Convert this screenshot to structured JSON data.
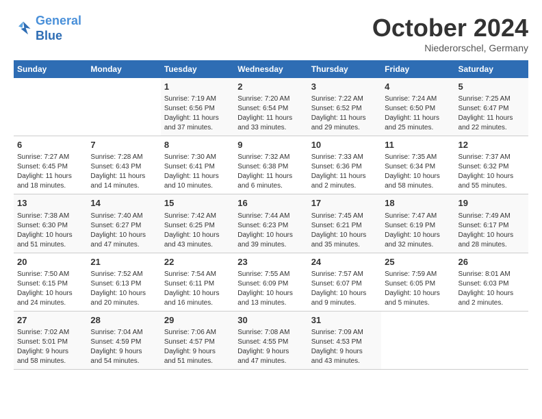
{
  "logo": {
    "line1": "General",
    "line2": "Blue"
  },
  "title": "October 2024",
  "location": "Niederorschel, Germany",
  "weekdays": [
    "Sunday",
    "Monday",
    "Tuesday",
    "Wednesday",
    "Thursday",
    "Friday",
    "Saturday"
  ],
  "weeks": [
    [
      {
        "day": "",
        "info": ""
      },
      {
        "day": "",
        "info": ""
      },
      {
        "day": "1",
        "info": "Sunrise: 7:19 AM\nSunset: 6:56 PM\nDaylight: 11 hours\nand 37 minutes."
      },
      {
        "day": "2",
        "info": "Sunrise: 7:20 AM\nSunset: 6:54 PM\nDaylight: 11 hours\nand 33 minutes."
      },
      {
        "day": "3",
        "info": "Sunrise: 7:22 AM\nSunset: 6:52 PM\nDaylight: 11 hours\nand 29 minutes."
      },
      {
        "day": "4",
        "info": "Sunrise: 7:24 AM\nSunset: 6:50 PM\nDaylight: 11 hours\nand 25 minutes."
      },
      {
        "day": "5",
        "info": "Sunrise: 7:25 AM\nSunset: 6:47 PM\nDaylight: 11 hours\nand 22 minutes."
      }
    ],
    [
      {
        "day": "6",
        "info": "Sunrise: 7:27 AM\nSunset: 6:45 PM\nDaylight: 11 hours\nand 18 minutes."
      },
      {
        "day": "7",
        "info": "Sunrise: 7:28 AM\nSunset: 6:43 PM\nDaylight: 11 hours\nand 14 minutes."
      },
      {
        "day": "8",
        "info": "Sunrise: 7:30 AM\nSunset: 6:41 PM\nDaylight: 11 hours\nand 10 minutes."
      },
      {
        "day": "9",
        "info": "Sunrise: 7:32 AM\nSunset: 6:38 PM\nDaylight: 11 hours\nand 6 minutes."
      },
      {
        "day": "10",
        "info": "Sunrise: 7:33 AM\nSunset: 6:36 PM\nDaylight: 11 hours\nand 2 minutes."
      },
      {
        "day": "11",
        "info": "Sunrise: 7:35 AM\nSunset: 6:34 PM\nDaylight: 10 hours\nand 58 minutes."
      },
      {
        "day": "12",
        "info": "Sunrise: 7:37 AM\nSunset: 6:32 PM\nDaylight: 10 hours\nand 55 minutes."
      }
    ],
    [
      {
        "day": "13",
        "info": "Sunrise: 7:38 AM\nSunset: 6:30 PM\nDaylight: 10 hours\nand 51 minutes."
      },
      {
        "day": "14",
        "info": "Sunrise: 7:40 AM\nSunset: 6:27 PM\nDaylight: 10 hours\nand 47 minutes."
      },
      {
        "day": "15",
        "info": "Sunrise: 7:42 AM\nSunset: 6:25 PM\nDaylight: 10 hours\nand 43 minutes."
      },
      {
        "day": "16",
        "info": "Sunrise: 7:44 AM\nSunset: 6:23 PM\nDaylight: 10 hours\nand 39 minutes."
      },
      {
        "day": "17",
        "info": "Sunrise: 7:45 AM\nSunset: 6:21 PM\nDaylight: 10 hours\nand 35 minutes."
      },
      {
        "day": "18",
        "info": "Sunrise: 7:47 AM\nSunset: 6:19 PM\nDaylight: 10 hours\nand 32 minutes."
      },
      {
        "day": "19",
        "info": "Sunrise: 7:49 AM\nSunset: 6:17 PM\nDaylight: 10 hours\nand 28 minutes."
      }
    ],
    [
      {
        "day": "20",
        "info": "Sunrise: 7:50 AM\nSunset: 6:15 PM\nDaylight: 10 hours\nand 24 minutes."
      },
      {
        "day": "21",
        "info": "Sunrise: 7:52 AM\nSunset: 6:13 PM\nDaylight: 10 hours\nand 20 minutes."
      },
      {
        "day": "22",
        "info": "Sunrise: 7:54 AM\nSunset: 6:11 PM\nDaylight: 10 hours\nand 16 minutes."
      },
      {
        "day": "23",
        "info": "Sunrise: 7:55 AM\nSunset: 6:09 PM\nDaylight: 10 hours\nand 13 minutes."
      },
      {
        "day": "24",
        "info": "Sunrise: 7:57 AM\nSunset: 6:07 PM\nDaylight: 10 hours\nand 9 minutes."
      },
      {
        "day": "25",
        "info": "Sunrise: 7:59 AM\nSunset: 6:05 PM\nDaylight: 10 hours\nand 5 minutes."
      },
      {
        "day": "26",
        "info": "Sunrise: 8:01 AM\nSunset: 6:03 PM\nDaylight: 10 hours\nand 2 minutes."
      }
    ],
    [
      {
        "day": "27",
        "info": "Sunrise: 7:02 AM\nSunset: 5:01 PM\nDaylight: 9 hours\nand 58 minutes."
      },
      {
        "day": "28",
        "info": "Sunrise: 7:04 AM\nSunset: 4:59 PM\nDaylight: 9 hours\nand 54 minutes."
      },
      {
        "day": "29",
        "info": "Sunrise: 7:06 AM\nSunset: 4:57 PM\nDaylight: 9 hours\nand 51 minutes."
      },
      {
        "day": "30",
        "info": "Sunrise: 7:08 AM\nSunset: 4:55 PM\nDaylight: 9 hours\nand 47 minutes."
      },
      {
        "day": "31",
        "info": "Sunrise: 7:09 AM\nSunset: 4:53 PM\nDaylight: 9 hours\nand 43 minutes."
      },
      {
        "day": "",
        "info": ""
      },
      {
        "day": "",
        "info": ""
      }
    ]
  ]
}
